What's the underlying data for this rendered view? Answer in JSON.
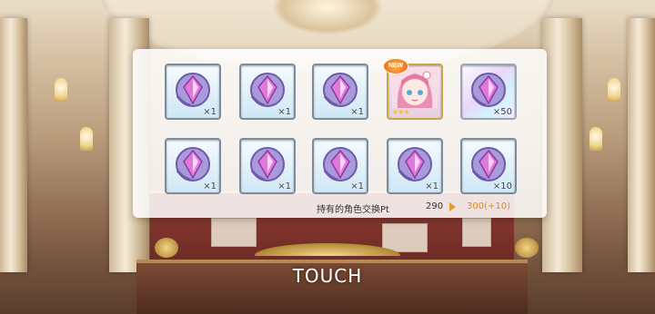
{
  "rewards": {
    "row1": [
      {
        "kind": "memory-piece-icon",
        "qty": "×1"
      },
      {
        "kind": "memory-piece-icon",
        "qty": "×1"
      },
      {
        "kind": "memory-piece-icon",
        "qty": "×1"
      },
      {
        "kind": "character-portrait-icon",
        "qty": "",
        "badge": "NEW",
        "stars": "★★★"
      },
      {
        "kind": "memory-piece-icon",
        "qty": "×50"
      }
    ],
    "row2": [
      {
        "kind": "memory-piece-icon",
        "qty": "×1"
      },
      {
        "kind": "memory-piece-icon",
        "qty": "×1"
      },
      {
        "kind": "memory-piece-icon",
        "qty": "×1"
      },
      {
        "kind": "memory-piece-icon",
        "qty": "×1"
      },
      {
        "kind": "memory-piece-icon",
        "qty": "×10"
      }
    ]
  },
  "footer": {
    "label": "持有的角色交换Pt",
    "current": "290",
    "new_value": "300(+10)"
  },
  "prompt": "TOUCH",
  "colors": {
    "accent_orange": "#e08a1d",
    "gem_purple": "#b44fd6"
  }
}
